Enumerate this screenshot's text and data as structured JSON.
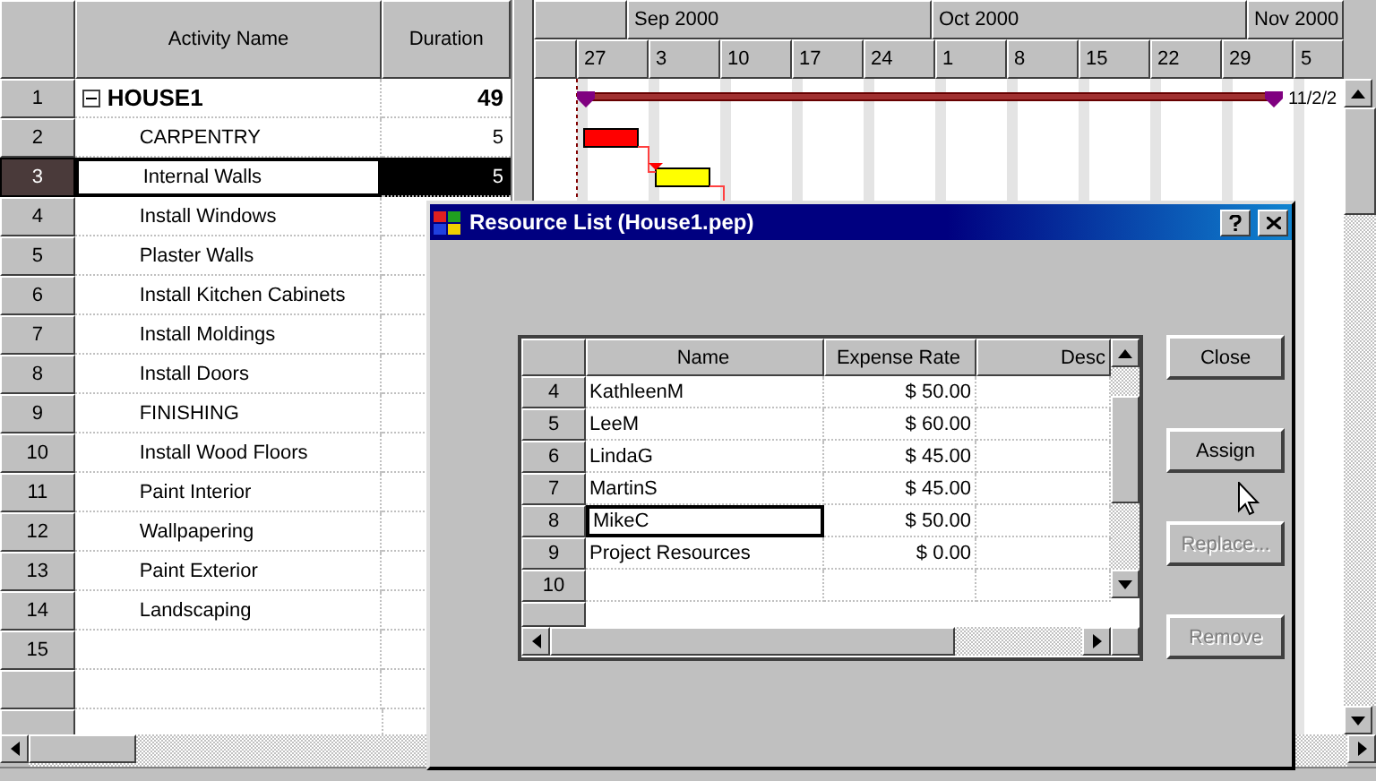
{
  "grid": {
    "columns": [
      "Activity Name",
      "Duration"
    ],
    "rows": [
      {
        "num": "1",
        "name": "HOUSE1",
        "duration": "49",
        "kind": "summary",
        "expanded": true,
        "selected": false
      },
      {
        "num": "2",
        "name": "CARPENTRY",
        "duration": "5",
        "kind": "task",
        "selected": false
      },
      {
        "num": "3",
        "name": "Internal Walls",
        "duration": "5",
        "kind": "task",
        "selected": true
      },
      {
        "num": "4",
        "name": "Install Windows",
        "kind": "task",
        "selected": false
      },
      {
        "num": "5",
        "name": "Plaster Walls",
        "kind": "task",
        "selected": false
      },
      {
        "num": "6",
        "name": "Install Kitchen Cabinets",
        "kind": "task",
        "selected": false
      },
      {
        "num": "7",
        "name": "Install Moldings",
        "kind": "task",
        "selected": false
      },
      {
        "num": "8",
        "name": "Install Doors",
        "kind": "task",
        "selected": false
      },
      {
        "num": "9",
        "name": "FINISHING",
        "kind": "task",
        "selected": false
      },
      {
        "num": "10",
        "name": "Install Wood Floors",
        "kind": "task",
        "selected": false
      },
      {
        "num": "11",
        "name": "Paint Interior",
        "kind": "task",
        "selected": false
      },
      {
        "num": "12",
        "name": "Wallpapering",
        "kind": "task",
        "selected": false
      },
      {
        "num": "13",
        "name": "Paint Exterior",
        "kind": "task",
        "selected": false
      },
      {
        "num": "14",
        "name": "Landscaping",
        "kind": "task",
        "selected": false
      },
      {
        "num": "15",
        "kind": "empty",
        "selected": false
      }
    ]
  },
  "gantt": {
    "months": [
      "Sep 2000",
      "Oct 2000",
      "Nov 2000"
    ],
    "weeks": [
      "27",
      "3",
      "10",
      "17",
      "24",
      "1",
      "8",
      "15",
      "22",
      "29",
      "5"
    ],
    "bars": [
      {
        "kind": "summary",
        "color": "#800080",
        "end_label": "11/2/2"
      },
      {
        "kind": "task",
        "color": "#ff0000"
      },
      {
        "kind": "task",
        "color": "#ffff00"
      }
    ]
  },
  "dialog": {
    "title": "Resource List (House1.pep)",
    "columns": [
      "Name",
      "Expense Rate",
      "Desc"
    ],
    "rows": [
      {
        "num": "4",
        "name": "KathleenM",
        "rate": "$ 50.00",
        "focused": false
      },
      {
        "num": "5",
        "name": "LeeM",
        "rate": "$ 60.00",
        "focused": false
      },
      {
        "num": "6",
        "name": "LindaG",
        "rate": "$ 45.00",
        "focused": false
      },
      {
        "num": "7",
        "name": "MartinS",
        "rate": "$ 45.00",
        "focused": false
      },
      {
        "num": "8",
        "name": "MikeC",
        "rate": "$ 50.00",
        "focused": true
      },
      {
        "num": "9",
        "name": "Project Resources",
        "rate": "$ 0.00",
        "focused": false
      },
      {
        "num": "10",
        "focused": false
      }
    ],
    "buttons": [
      {
        "label": "Close",
        "disabled": false
      },
      {
        "label": "Assign",
        "disabled": false
      },
      {
        "label": "Replace...",
        "disabled": true
      },
      {
        "label": "Remove",
        "disabled": true
      }
    ]
  }
}
